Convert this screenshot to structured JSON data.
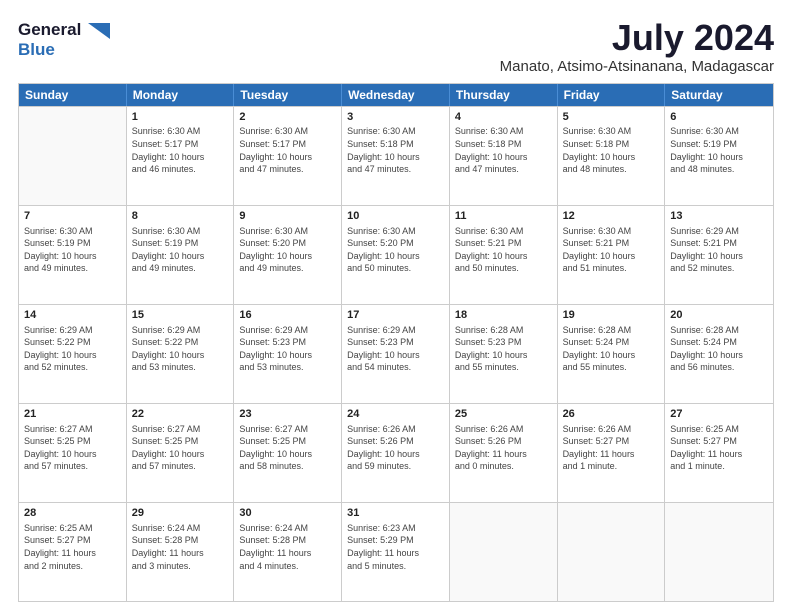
{
  "header": {
    "logo_general": "General",
    "logo_blue": "Blue",
    "month_title": "July 2024",
    "location": "Manato, Atsimo-Atsinanana, Madagascar"
  },
  "calendar": {
    "days_of_week": [
      "Sunday",
      "Monday",
      "Tuesday",
      "Wednesday",
      "Thursday",
      "Friday",
      "Saturday"
    ],
    "weeks": [
      [
        {
          "day": "",
          "info": ""
        },
        {
          "day": "1",
          "info": "Sunrise: 6:30 AM\nSunset: 5:17 PM\nDaylight: 10 hours\nand 46 minutes."
        },
        {
          "day": "2",
          "info": "Sunrise: 6:30 AM\nSunset: 5:17 PM\nDaylight: 10 hours\nand 47 minutes."
        },
        {
          "day": "3",
          "info": "Sunrise: 6:30 AM\nSunset: 5:18 PM\nDaylight: 10 hours\nand 47 minutes."
        },
        {
          "day": "4",
          "info": "Sunrise: 6:30 AM\nSunset: 5:18 PM\nDaylight: 10 hours\nand 47 minutes."
        },
        {
          "day": "5",
          "info": "Sunrise: 6:30 AM\nSunset: 5:18 PM\nDaylight: 10 hours\nand 48 minutes."
        },
        {
          "day": "6",
          "info": "Sunrise: 6:30 AM\nSunset: 5:19 PM\nDaylight: 10 hours\nand 48 minutes."
        }
      ],
      [
        {
          "day": "7",
          "info": "Sunrise: 6:30 AM\nSunset: 5:19 PM\nDaylight: 10 hours\nand 49 minutes."
        },
        {
          "day": "8",
          "info": "Sunrise: 6:30 AM\nSunset: 5:19 PM\nDaylight: 10 hours\nand 49 minutes."
        },
        {
          "day": "9",
          "info": "Sunrise: 6:30 AM\nSunset: 5:20 PM\nDaylight: 10 hours\nand 49 minutes."
        },
        {
          "day": "10",
          "info": "Sunrise: 6:30 AM\nSunset: 5:20 PM\nDaylight: 10 hours\nand 50 minutes."
        },
        {
          "day": "11",
          "info": "Sunrise: 6:30 AM\nSunset: 5:21 PM\nDaylight: 10 hours\nand 50 minutes."
        },
        {
          "day": "12",
          "info": "Sunrise: 6:30 AM\nSunset: 5:21 PM\nDaylight: 10 hours\nand 51 minutes."
        },
        {
          "day": "13",
          "info": "Sunrise: 6:29 AM\nSunset: 5:21 PM\nDaylight: 10 hours\nand 52 minutes."
        }
      ],
      [
        {
          "day": "14",
          "info": "Sunrise: 6:29 AM\nSunset: 5:22 PM\nDaylight: 10 hours\nand 52 minutes."
        },
        {
          "day": "15",
          "info": "Sunrise: 6:29 AM\nSunset: 5:22 PM\nDaylight: 10 hours\nand 53 minutes."
        },
        {
          "day": "16",
          "info": "Sunrise: 6:29 AM\nSunset: 5:23 PM\nDaylight: 10 hours\nand 53 minutes."
        },
        {
          "day": "17",
          "info": "Sunrise: 6:29 AM\nSunset: 5:23 PM\nDaylight: 10 hours\nand 54 minutes."
        },
        {
          "day": "18",
          "info": "Sunrise: 6:28 AM\nSunset: 5:23 PM\nDaylight: 10 hours\nand 55 minutes."
        },
        {
          "day": "19",
          "info": "Sunrise: 6:28 AM\nSunset: 5:24 PM\nDaylight: 10 hours\nand 55 minutes."
        },
        {
          "day": "20",
          "info": "Sunrise: 6:28 AM\nSunset: 5:24 PM\nDaylight: 10 hours\nand 56 minutes."
        }
      ],
      [
        {
          "day": "21",
          "info": "Sunrise: 6:27 AM\nSunset: 5:25 PM\nDaylight: 10 hours\nand 57 minutes."
        },
        {
          "day": "22",
          "info": "Sunrise: 6:27 AM\nSunset: 5:25 PM\nDaylight: 10 hours\nand 57 minutes."
        },
        {
          "day": "23",
          "info": "Sunrise: 6:27 AM\nSunset: 5:25 PM\nDaylight: 10 hours\nand 58 minutes."
        },
        {
          "day": "24",
          "info": "Sunrise: 6:26 AM\nSunset: 5:26 PM\nDaylight: 10 hours\nand 59 minutes."
        },
        {
          "day": "25",
          "info": "Sunrise: 6:26 AM\nSunset: 5:26 PM\nDaylight: 11 hours\nand 0 minutes."
        },
        {
          "day": "26",
          "info": "Sunrise: 6:26 AM\nSunset: 5:27 PM\nDaylight: 11 hours\nand 1 minute."
        },
        {
          "day": "27",
          "info": "Sunrise: 6:25 AM\nSunset: 5:27 PM\nDaylight: 11 hours\nand 1 minute."
        }
      ],
      [
        {
          "day": "28",
          "info": "Sunrise: 6:25 AM\nSunset: 5:27 PM\nDaylight: 11 hours\nand 2 minutes."
        },
        {
          "day": "29",
          "info": "Sunrise: 6:24 AM\nSunset: 5:28 PM\nDaylight: 11 hours\nand 3 minutes."
        },
        {
          "day": "30",
          "info": "Sunrise: 6:24 AM\nSunset: 5:28 PM\nDaylight: 11 hours\nand 4 minutes."
        },
        {
          "day": "31",
          "info": "Sunrise: 6:23 AM\nSunset: 5:29 PM\nDaylight: 11 hours\nand 5 minutes."
        },
        {
          "day": "",
          "info": ""
        },
        {
          "day": "",
          "info": ""
        },
        {
          "day": "",
          "info": ""
        }
      ]
    ]
  }
}
